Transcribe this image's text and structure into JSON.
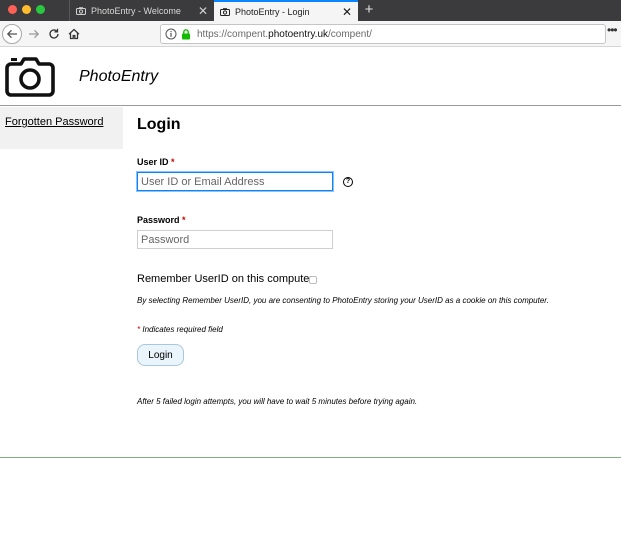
{
  "browser": {
    "tabs": [
      {
        "title": "PhotoEntry - Welcome",
        "active": false
      },
      {
        "title": "PhotoEntry - Login",
        "active": true
      }
    ],
    "close_glyph": "✕",
    "new_tab_glyph": "+",
    "url_protocol": "https://compent.",
    "url_host": "photoentry.uk",
    "url_path": "/compent/",
    "menu_glyph": "•••"
  },
  "header": {
    "site_title": "PhotoEntry"
  },
  "sidebar": {
    "forgot_password": "Forgotten Password"
  },
  "form": {
    "heading": "Login",
    "required_marker": "*",
    "userid_label": "User ID",
    "userid_placeholder": "User ID or Email Address",
    "help_glyph": "?",
    "password_label": "Password",
    "password_placeholder": "Password",
    "remember_label": "Remember UserID on this computer",
    "consent_note": "By selecting Remember UserID, you are consenting to PhotoEntry storing your UserID as a cookie on this computer.",
    "required_note": "Indicates required field",
    "login_button": "Login",
    "lockout_note": "After 5 failed login attempts, you will have to wait 5 minutes before trying again."
  },
  "colors": {
    "accent": "#0a84ff",
    "required": "#cc0000",
    "footer_rule": "#7fb07f"
  }
}
